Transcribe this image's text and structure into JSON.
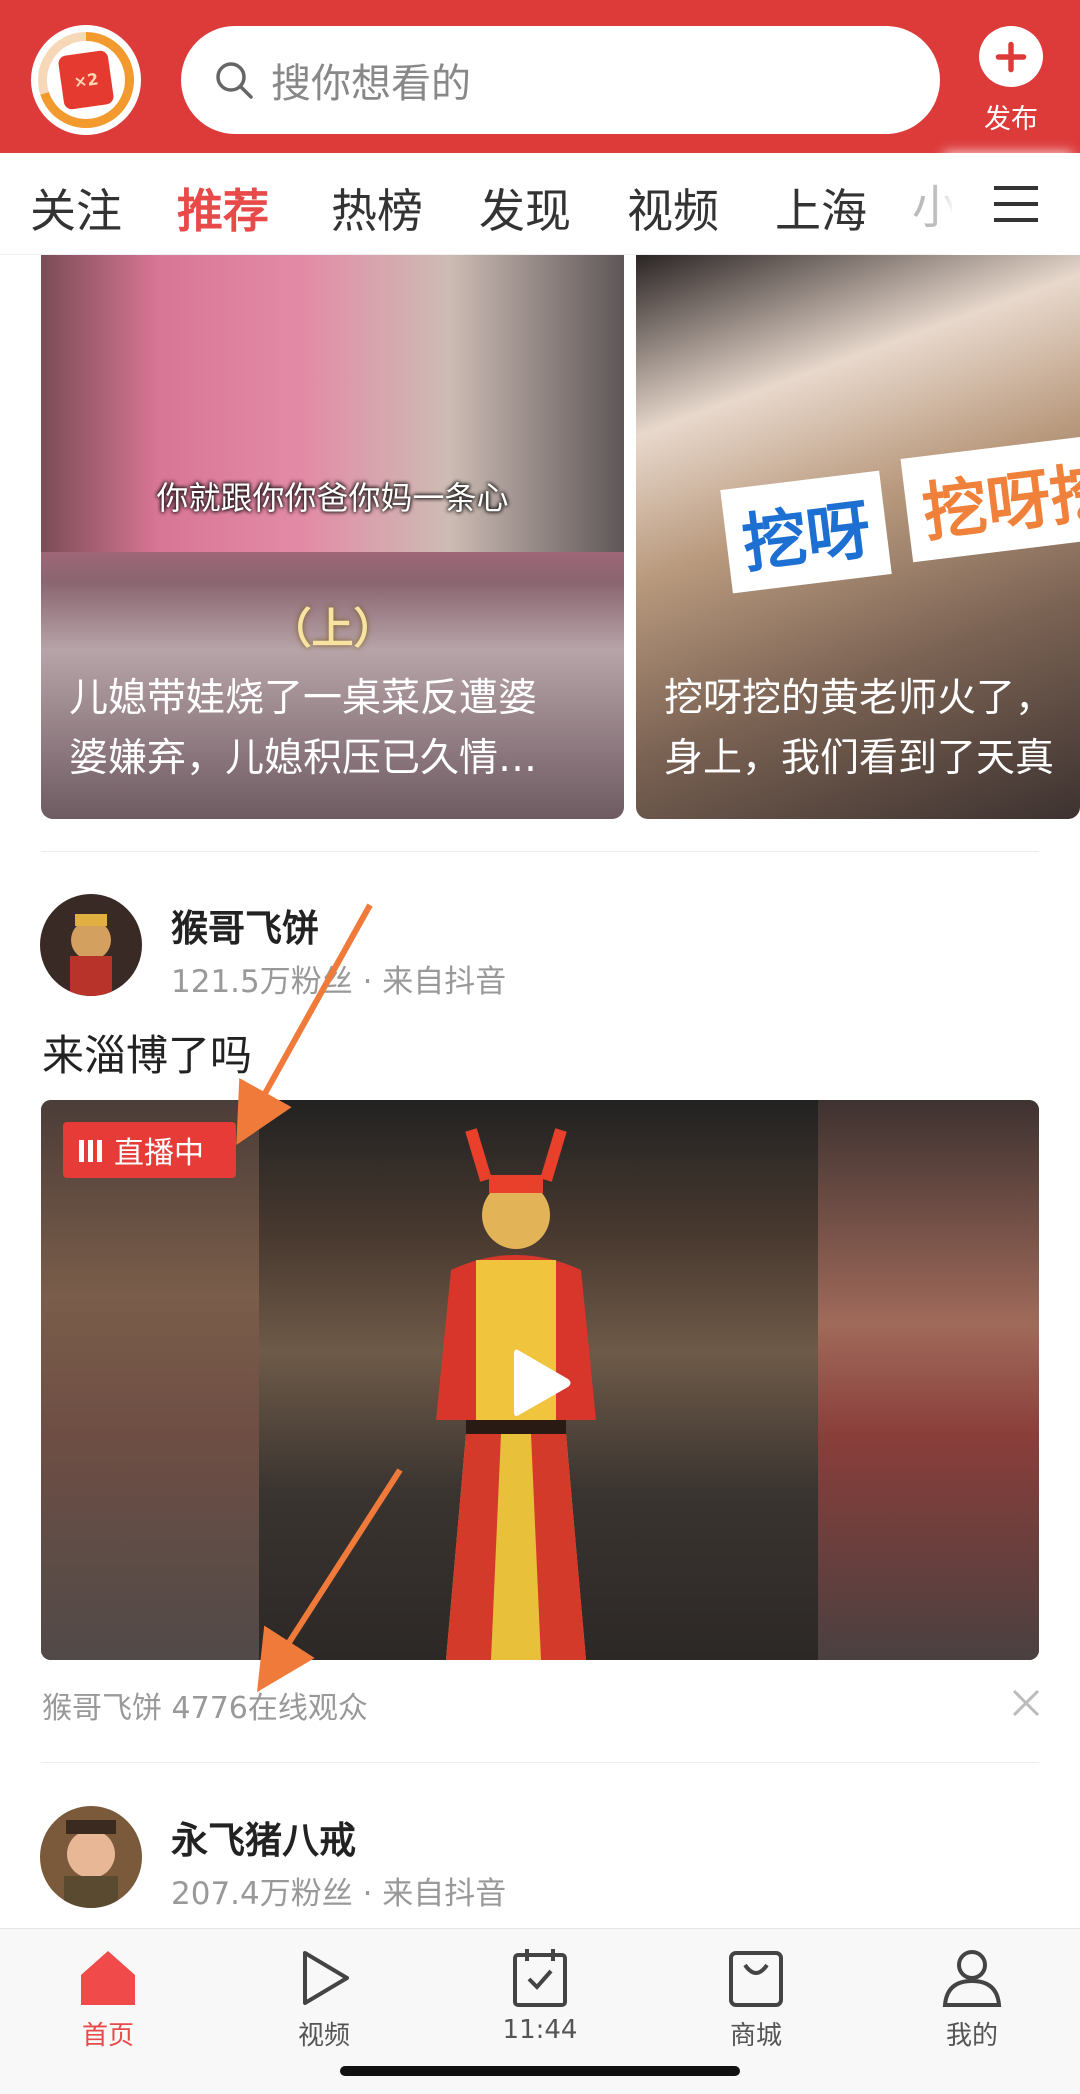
{
  "header": {
    "badge_text": "×2",
    "search_placeholder": "搜你想看的",
    "publish_label": "发布",
    "accent_color": "#dd3a3a"
  },
  "tabs": [
    {
      "label": "关注",
      "active": false
    },
    {
      "label": "推荐",
      "active": true
    },
    {
      "label": "热榜",
      "active": false
    },
    {
      "label": "发现",
      "active": false
    },
    {
      "label": "视频",
      "active": false
    },
    {
      "label": "上海",
      "active": false
    },
    {
      "label": "小",
      "active": false
    }
  ],
  "feed": {
    "cards": [
      {
        "subtitle": "你就跟你你爸你妈一条心",
        "overlay": "（上）",
        "title_line1": "儿媳带娃烧了一桌菜反遭婆",
        "title_line2": "婆嫌弃，儿媳积压已久情…"
      },
      {
        "badge1": "挖呀",
        "badge2": "挖呀挖",
        "title_line1": "挖呀挖的黄老师火了，",
        "title_line2": "身上，我们看到了天真"
      }
    ],
    "post1": {
      "author": "猴哥飞饼",
      "meta": "121.5万粉丝 · 来自抖音",
      "text": "来淄博了吗",
      "live_badge": "直播中",
      "caption": "猴哥飞饼 4776在线观众"
    },
    "post2": {
      "author": "永飞猪八戒",
      "meta": "207.4万粉丝 · 来自抖音"
    }
  },
  "bottom_nav": [
    {
      "label": "首页",
      "icon": "home-icon",
      "active": true
    },
    {
      "label": "视频",
      "icon": "play-icon",
      "active": false
    },
    {
      "label": "11:44",
      "icon": "calendar-check-icon",
      "active": false
    },
    {
      "label": "商城",
      "icon": "shopping-bag-icon",
      "active": false
    },
    {
      "label": "我的",
      "icon": "user-icon",
      "active": false
    }
  ]
}
